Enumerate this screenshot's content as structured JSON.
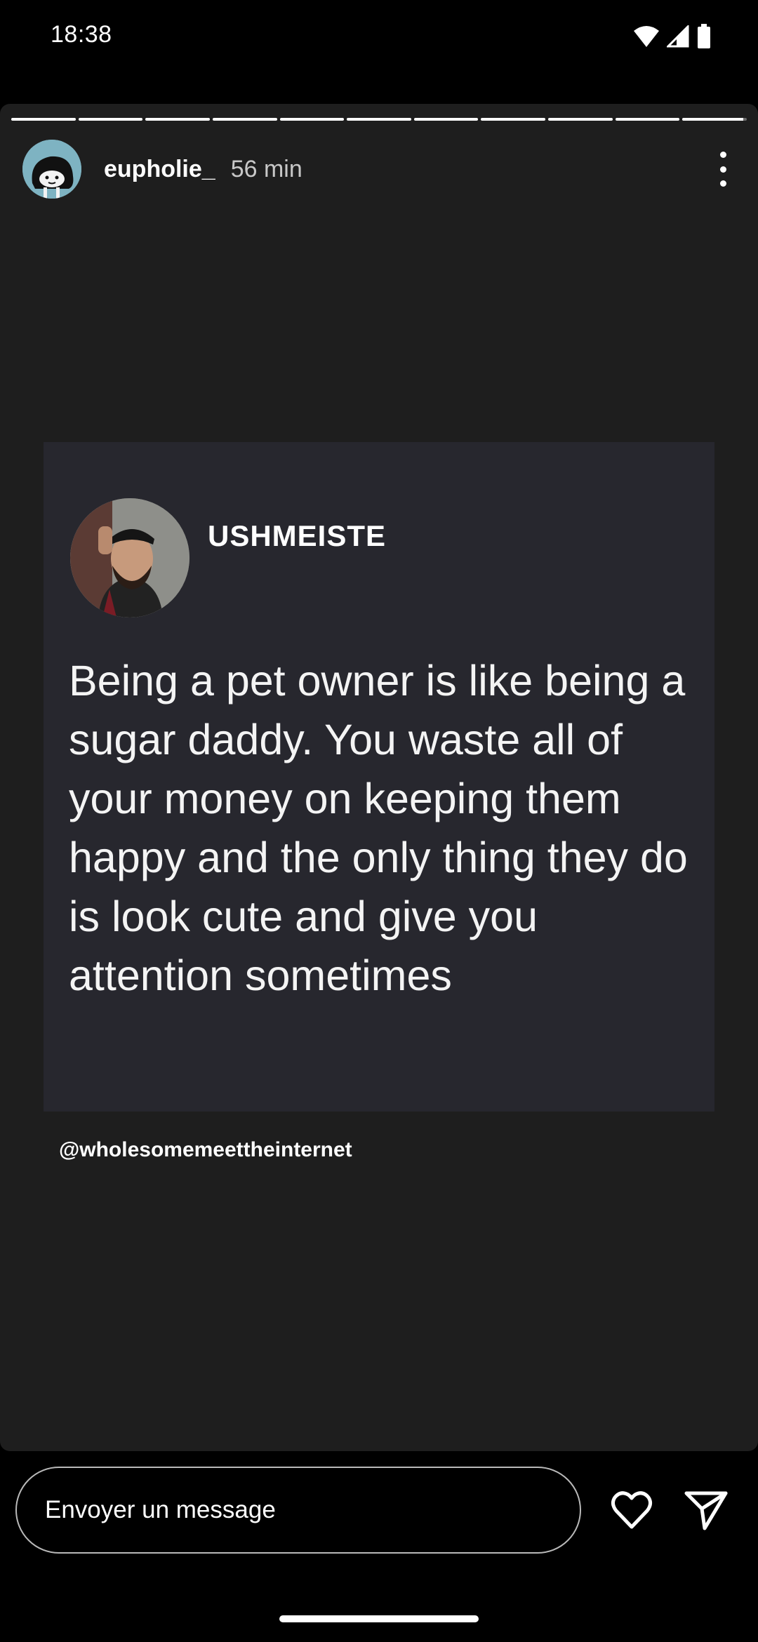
{
  "status_bar": {
    "time": "18:38",
    "icons": [
      "wifi-icon",
      "cellular-signal-icon",
      "battery-icon"
    ]
  },
  "story": {
    "progress": {
      "segment_count": 11,
      "segments_complete": 10,
      "current_segment_fraction": 0.95
    },
    "header": {
      "username": "eupholie_",
      "time_ago": "56 min"
    },
    "post": {
      "author": "USHMEISTE",
      "text": "Being a pet owner is like being a sugar daddy. You waste all of your money on keeping them happy and the only thing they do is look cute and give you attention sometimes"
    },
    "credit": "@wholesomemeettheinternet"
  },
  "reply_bar": {
    "placeholder": "Envoyer un message",
    "icons": [
      "heart-icon",
      "send-icon"
    ]
  },
  "colors": {
    "story_background": "#1e1e1e",
    "card_background": "#27272e",
    "screen_background": "#000000"
  }
}
